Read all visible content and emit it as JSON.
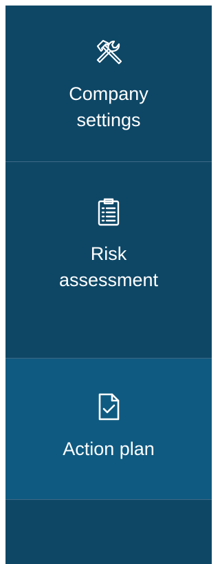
{
  "sidebar": {
    "colors": {
      "background": "#0e4766",
      "active_background": "#0f5a81",
      "divider": "#3d6a85",
      "text": "#ffffff"
    },
    "items": [
      {
        "label_line1": "Company",
        "label_line2": "settings",
        "icon": "tools-icon",
        "active": false
      },
      {
        "label_line1": "Risk",
        "label_line2": "assessment",
        "icon": "clipboard-list-icon",
        "active": false
      },
      {
        "label_line1": "Action plan",
        "label_line2": "",
        "icon": "document-check-icon",
        "active": true
      }
    ]
  }
}
